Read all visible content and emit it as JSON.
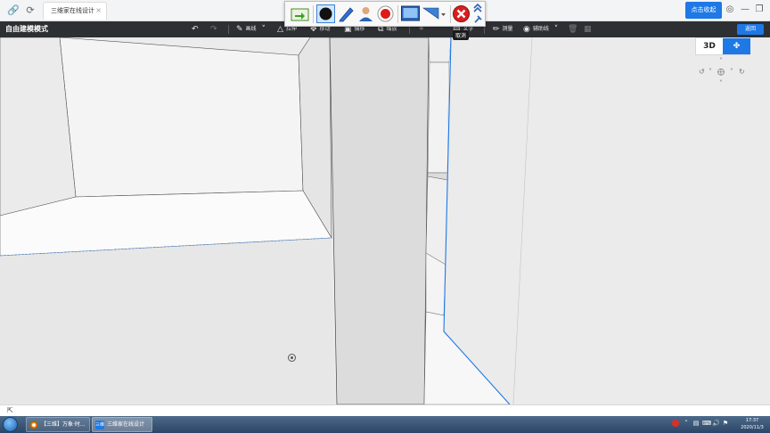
{
  "browser": {
    "tab_title": "三维家在线设计",
    "tab_close": "×",
    "collect_label": "点击收起",
    "link_icon": "link-icon",
    "refresh_icon": "refresh-icon"
  },
  "recorder": {
    "tooltip": "取消"
  },
  "app": {
    "mode_title": "自由建模模式",
    "tools": {
      "draw": "画线",
      "push": "拉伸",
      "move": "移动",
      "offset": "偏移",
      "scale": "缩放",
      "text": "文字",
      "measure": "测量",
      "guide": "辅助线"
    },
    "back_label": "返回"
  },
  "view": {
    "mode_3d": "3D",
    "walk_icon": "walk-icon"
  },
  "taskbar": {
    "items": [
      {
        "label": "【三维】万象·时..."
      },
      {
        "label": "三维家在线设计"
      }
    ],
    "tray_brand": "三维",
    "clock_time": "17:37",
    "clock_date": "2020/11/3"
  },
  "colors": {
    "accent": "#1e78e6",
    "toolbar_bg": "#2e2f33",
    "selection_edge": "#1e78e6"
  }
}
